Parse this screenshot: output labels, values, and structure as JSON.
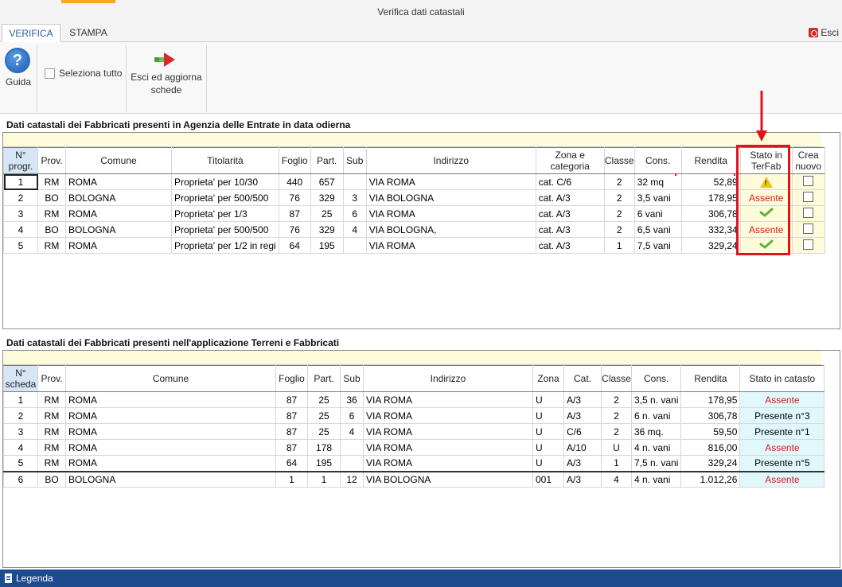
{
  "window": {
    "title": "Verifica dati catastali"
  },
  "tabs": [
    {
      "label": "VERIFICA"
    },
    {
      "label": "STAMPA"
    }
  ],
  "exit_label": "Esci",
  "ribbon": {
    "help_label": "Guida",
    "select_all_label": "Seleziona tutto",
    "update_line1": "Esci ed aggiorna",
    "update_line2": "schede"
  },
  "agenzia": {
    "title": "Dati catastali dei Fabbricati presenti in Agenzia delle Entrate in data odierna",
    "headers": [
      "N° progr.",
      "Prov.",
      "Comune",
      "Titolarità",
      "Foglio",
      "Part.",
      "Sub",
      "Indirizzo",
      "Zona e categoria",
      "Classe",
      "Cons.",
      "Rendita",
      "Stato in TerFab",
      "Crea nuovo"
    ],
    "rows": [
      [
        "1",
        "RM",
        "ROMA",
        "Proprieta' per 10/30",
        "440",
        "657",
        "",
        "VIA ROMA",
        "cat. C/6",
        "2",
        "32 mq",
        "52,89",
        "warning",
        ""
      ],
      [
        "2",
        "BO",
        "BOLOGNA",
        "Proprieta' per 500/500",
        "76",
        "329",
        "3",
        "VIA BOLOGNA",
        "cat. A/3",
        "2",
        "3,5 vani",
        "178,95",
        "Assente",
        ""
      ],
      [
        "3",
        "RM",
        "ROMA",
        "Proprieta' per 1/3",
        "87",
        "25",
        "6",
        "VIA ROMA",
        "cat. A/3",
        "2",
        "6 vani",
        "306,78",
        "check",
        ""
      ],
      [
        "4",
        "BO",
        "BOLOGNA",
        "Proprieta' per 500/500",
        "76",
        "329",
        "4",
        "VIA BOLOGNA,",
        "cat. A/3",
        "2",
        "6,5 vani",
        "332,34",
        "Assente",
        ""
      ],
      [
        "5",
        "RM",
        "ROMA",
        "Proprieta' per 1/2 in regi",
        "64",
        "195",
        "",
        "VIA ROMA",
        "cat. A/3",
        "1",
        "7,5 vani",
        "329,24",
        "check",
        ""
      ]
    ]
  },
  "terfab": {
    "title": "Dati catastali dei Fabbricati presenti nell'applicazione Terreni e Fabbricati",
    "headers": [
      "N° scheda",
      "Prov.",
      "Comune",
      "Foglio",
      "Part.",
      "Sub",
      "Indirizzo",
      "Zona",
      "Cat.",
      "Classe",
      "Cons.",
      "Rendita",
      "Stato in catasto"
    ],
    "rows": [
      [
        "1",
        "RM",
        "ROMA",
        "87",
        "25",
        "36",
        "VIA ROMA",
        "U",
        "A/3",
        "2",
        "3,5 n. vani",
        "178,95",
        "Assente"
      ],
      [
        "2",
        "RM",
        "ROMA",
        "87",
        "25",
        "6",
        "VIA ROMA",
        "U",
        "A/3",
        "2",
        "6 n. vani",
        "306,78",
        "Presente n°3"
      ],
      [
        "3",
        "RM",
        "ROMA",
        "87",
        "25",
        "4",
        "VIA ROMA",
        "U",
        "C/6",
        "2",
        "36 mq.",
        "59,50",
        "Presente n°1"
      ],
      [
        "4",
        "RM",
        "ROMA",
        "87",
        "178",
        "",
        "VIA ROMA",
        "U",
        "A/10",
        "U",
        "4 n. vani",
        "816,00",
        "Assente"
      ],
      [
        "5",
        "RM",
        "ROMA",
        "64",
        "195",
        "",
        "VIA ROMA",
        "U",
        "A/3",
        "1",
        "7,5 n. vani",
        "329,24",
        "Presente n°5"
      ],
      [
        "6",
        "BO",
        "BOLOGNA",
        "1",
        "1",
        "12",
        "VIA BOLOGNA",
        "001",
        "A/3",
        "4",
        "4 n. vani",
        "1.012,26",
        "Assente"
      ]
    ]
  },
  "status_bar": {
    "label": "Legenda"
  },
  "colors": {
    "accent_tab": "#f5a623",
    "status_bar": "#1d4b8f",
    "assente": "#d0201e",
    "highlight_box": "#e0121a"
  }
}
